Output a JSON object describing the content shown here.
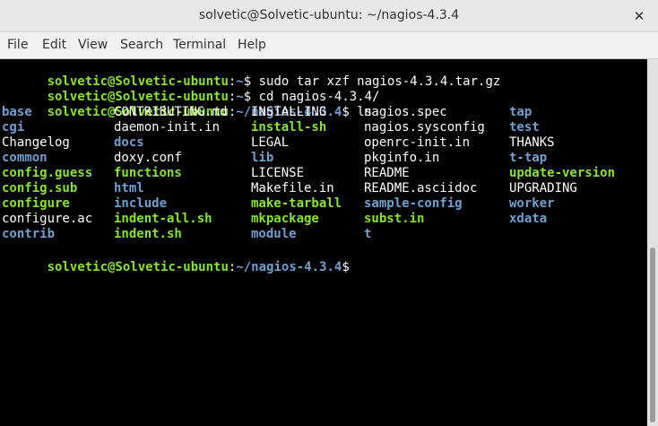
{
  "window": {
    "title": "solvetic@Solvetic-ubuntu: ~/nagios-4.3.4",
    "close_glyph": "✕"
  },
  "menu": [
    "File",
    "Edit",
    "View",
    "Search",
    "Terminal",
    "Help"
  ],
  "terminal": {
    "colors": {
      "prompt": "#8ae234",
      "path": "#729fcf",
      "directory": "#729fcf",
      "executable": "#8ae234",
      "text": "#ffffff",
      "background": "#000000"
    },
    "lines": [
      {
        "user_host": "solvetic@Solvetic-ubuntu",
        "sep": ":",
        "path": "~",
        "symbol": "$ ",
        "command": "sudo tar xzf nagios-4.3.4.tar.gz"
      },
      {
        "user_host": "solvetic@Solvetic-ubuntu",
        "sep": ":",
        "path": "~",
        "symbol": "$ ",
        "command": "cd nagios-4.3.4/"
      },
      {
        "user_host": "solvetic@Solvetic-ubuntu",
        "sep": ":",
        "path": "~/nagios-4.3.4",
        "symbol": "$ ",
        "command": "ls"
      }
    ],
    "ls_columns": [
      [
        {
          "name": "base",
          "type": "dir"
        },
        {
          "name": "cgi",
          "type": "dir"
        },
        {
          "name": "Changelog",
          "type": "file"
        },
        {
          "name": "common",
          "type": "dir"
        },
        {
          "name": "config.guess",
          "type": "exe"
        },
        {
          "name": "config.sub",
          "type": "exe"
        },
        {
          "name": "configure",
          "type": "exe"
        },
        {
          "name": "configure.ac",
          "type": "file"
        },
        {
          "name": "contrib",
          "type": "dir"
        }
      ],
      [
        {
          "name": "CONTRIBUTING.md",
          "type": "file"
        },
        {
          "name": "daemon-init.in",
          "type": "file"
        },
        {
          "name": "docs",
          "type": "dir"
        },
        {
          "name": "doxy.conf",
          "type": "file"
        },
        {
          "name": "functions",
          "type": "exe"
        },
        {
          "name": "html",
          "type": "dir"
        },
        {
          "name": "include",
          "type": "dir"
        },
        {
          "name": "indent-all.sh",
          "type": "exe"
        },
        {
          "name": "indent.sh",
          "type": "exe"
        }
      ],
      [
        {
          "name": "INSTALLING",
          "type": "file"
        },
        {
          "name": "install-sh",
          "type": "exe"
        },
        {
          "name": "LEGAL",
          "type": "file"
        },
        {
          "name": "lib",
          "type": "dir"
        },
        {
          "name": "LICENSE",
          "type": "file"
        },
        {
          "name": "Makefile.in",
          "type": "file"
        },
        {
          "name": "make-tarball",
          "type": "exe"
        },
        {
          "name": "mkpackage",
          "type": "exe"
        },
        {
          "name": "module",
          "type": "dir"
        }
      ],
      [
        {
          "name": "nagios.spec",
          "type": "file"
        },
        {
          "name": "nagios.sysconfig",
          "type": "file"
        },
        {
          "name": "openrc-init.in",
          "type": "file"
        },
        {
          "name": "pkginfo.in",
          "type": "file"
        },
        {
          "name": "README",
          "type": "file"
        },
        {
          "name": "README.asciidoc",
          "type": "file"
        },
        {
          "name": "sample-config",
          "type": "dir"
        },
        {
          "name": "subst.in",
          "type": "exe"
        },
        {
          "name": "t",
          "type": "dir"
        }
      ],
      [
        {
          "name": "tap",
          "type": "dir"
        },
        {
          "name": "test",
          "type": "dir"
        },
        {
          "name": "THANKS",
          "type": "file"
        },
        {
          "name": "t-tap",
          "type": "dir"
        },
        {
          "name": "update-version",
          "type": "exe"
        },
        {
          "name": "UPGRADING",
          "type": "file"
        },
        {
          "name": "worker",
          "type": "dir"
        },
        {
          "name": "xdata",
          "type": "dir"
        }
      ]
    ],
    "final_prompt": {
      "user_host": "solvetic@Solvetic-ubuntu",
      "sep": ":",
      "path": "~/nagios-4.3.4",
      "symbol": "$"
    }
  },
  "scrollbar": {
    "position": "bottom"
  }
}
